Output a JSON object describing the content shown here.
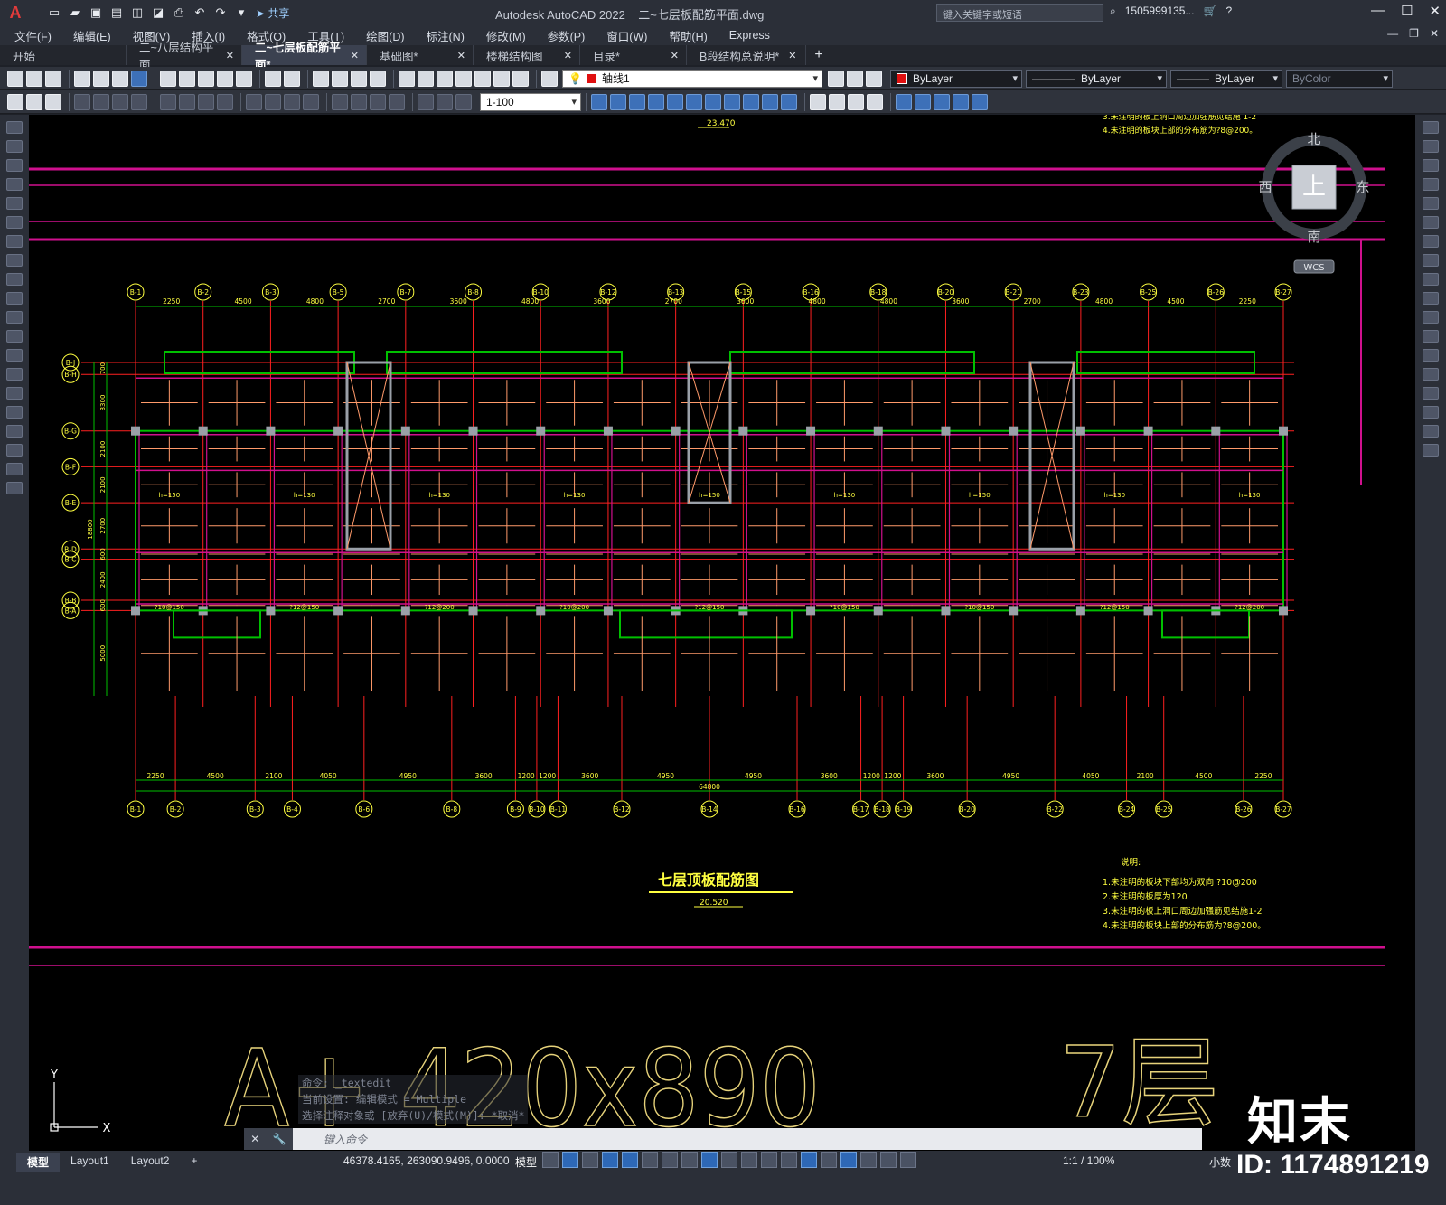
{
  "app": {
    "title": "Autodesk AutoCAD 2022",
    "file": "二~七层板配筋平面.dwg",
    "share_label": "共享",
    "search_placeholder": "键入关键字或短语",
    "user": "1505999135...",
    "logo_letter": "A"
  },
  "menu": [
    "文件(F)",
    "编辑(E)",
    "视图(V)",
    "插入(I)",
    "格式(O)",
    "工具(T)",
    "绘图(D)",
    "标注(N)",
    "修改(M)",
    "参数(P)",
    "窗口(W)",
    "帮助(H)",
    "Express"
  ],
  "tabs": [
    {
      "label": "开始",
      "active": false,
      "closable": false
    },
    {
      "label": "二~八层结构平面",
      "active": false,
      "closable": true
    },
    {
      "label": "二~七层板配筋平面*",
      "active": true,
      "closable": true
    },
    {
      "label": "基础图*",
      "active": false,
      "closable": true
    },
    {
      "label": "楼梯结构图",
      "active": false,
      "closable": true
    },
    {
      "label": "目录*",
      "active": false,
      "closable": true
    },
    {
      "label": "B段结构总说明*",
      "active": false,
      "closable": true
    }
  ],
  "toolbar": {
    "layer": "轴线1",
    "color": "ByLayer",
    "linetype": "ByLayer",
    "lineweight": "ByLayer",
    "plotstyle": "ByColor",
    "scale": "1-100"
  },
  "viewcube": {
    "north": "北",
    "south": "南",
    "east": "东",
    "west": "西",
    "top": "上",
    "wcs": "WCS"
  },
  "drawing": {
    "title": "七层顶板配筋图",
    "title_elev": "20.520",
    "top_elev": "23.470",
    "notes_heading": "说明:",
    "notes": [
      "1.未注明的板块下部均为双向 ?10@200",
      "2.未注明的板厚为120",
      "3.未注明的板上洞口周边加强筋见结施1-2",
      "4.未注明的板块上部的分布筋为?8@200。"
    ],
    "notes_top": [
      "3.未注明的板上洞口周边加强筋见结施 1-2",
      "4.未注明的板块上部的分布筋为?8@200。"
    ],
    "total_dim": "64800",
    "top_axes": [
      "B-1",
      "B-2",
      "B-3",
      "B-5",
      "B-7",
      "B-8",
      "B-10",
      "B-12",
      "B-13",
      "B-15",
      "B-16",
      "B-18",
      "B-20",
      "B-21",
      "B-23",
      "B-25",
      "B-26",
      "B-27"
    ],
    "top_dims": [
      "2250",
      "4500",
      "4800",
      "2700",
      "3600",
      "4800",
      "3600",
      "2700",
      "3600",
      "4800",
      "4800",
      "3600",
      "2700",
      "4800",
      "4500",
      "2250"
    ],
    "bottom_axes": [
      "B-1",
      "B-2",
      "B-3",
      "B-4",
      "B-6",
      "B-8",
      "B-9",
      "B-10",
      "B-11",
      "B-12",
      "B-14",
      "B-16",
      "B-17",
      "B-18",
      "B-19",
      "B-20",
      "B-22",
      "B-24",
      "B-25",
      "B-26",
      "B-27"
    ],
    "bottom_dims": [
      "2250",
      "4500",
      "2100",
      "4050",
      "4950",
      "3600",
      "1200",
      "1200",
      "3600",
      "4950",
      "4950",
      "3600",
      "1200",
      "1200",
      "3600",
      "4950",
      "4050",
      "2100",
      "4500",
      "2250"
    ],
    "left_axes": [
      "B-J",
      "B-H",
      "B-G",
      "B-F",
      "B-E",
      "B-D",
      "B-C",
      "B-B",
      "B-A"
    ],
    "left_dims": [
      "700",
      "3300",
      "2100",
      "2100",
      "2700",
      "600",
      "2400",
      "600",
      "5000"
    ],
    "side_total": "18800",
    "big_text_left": "A+ 420x890",
    "big_text_right": "7层",
    "room_labels": [
      "h=150",
      "h=130",
      "h=130",
      "h=130",
      "h=150",
      "h=130"
    ],
    "rebar_labels": [
      "?10@150",
      "?12@150",
      "?12@200",
      "?10@200",
      "?12@150",
      "?10@150"
    ]
  },
  "command": {
    "history": [
      "命令: _textedit",
      "当前设置: 编辑模式 = Multiple",
      "选择注释对象或 [放弃(U)/模式(M)]: *取消*"
    ],
    "placeholder": "键入命令"
  },
  "status": {
    "layouts": [
      "模型",
      "Layout1",
      "Layout2"
    ],
    "coords": "46378.4165, 263090.9496, 0.0000",
    "space": "模型",
    "scale": "1:1 / 100%",
    "units": "小数"
  },
  "watermark": {
    "logo": "知末",
    "id": "ID: 1174891219"
  },
  "colors": {
    "canvas": "#000000",
    "axis_red": "#ff2020",
    "wall_green": "#00c000",
    "beam_magenta": "#d0108e",
    "rebar": "#ff9a6a",
    "text_yellow": "#ffff40"
  }
}
